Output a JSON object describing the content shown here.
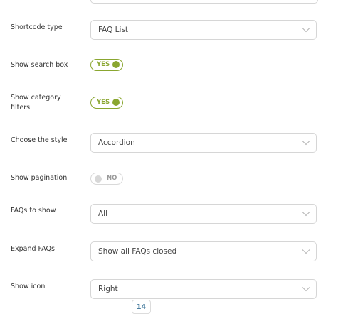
{
  "settings": {
    "shortcode_type": {
      "label": "Shortcode type",
      "value": "FAQ List"
    },
    "show_search_box": {
      "label": "Show search box",
      "toggle": "YES",
      "enabled": true
    },
    "show_category_filters": {
      "label": "Show category filters",
      "toggle": "YES",
      "enabled": true
    },
    "choose_style": {
      "label": "Choose the style",
      "value": "Accordion"
    },
    "show_pagination": {
      "label": "Show pagination",
      "toggle": "NO",
      "enabled": false
    },
    "faqs_to_show": {
      "label": "FAQs to show",
      "value": "All"
    },
    "expand_faqs": {
      "label": "Expand FAQs",
      "value": "Show all FAQs closed"
    },
    "show_icon": {
      "label": "Show icon",
      "value": "Right"
    }
  },
  "page_badge": "14",
  "icons": {
    "dropdown": "chevron-down-icon",
    "toggle_knob": "toggle-knob"
  },
  "colors": {
    "accent": "#8aa630",
    "border": "#d6d6d6",
    "badge_text": "#4a7ea0"
  }
}
